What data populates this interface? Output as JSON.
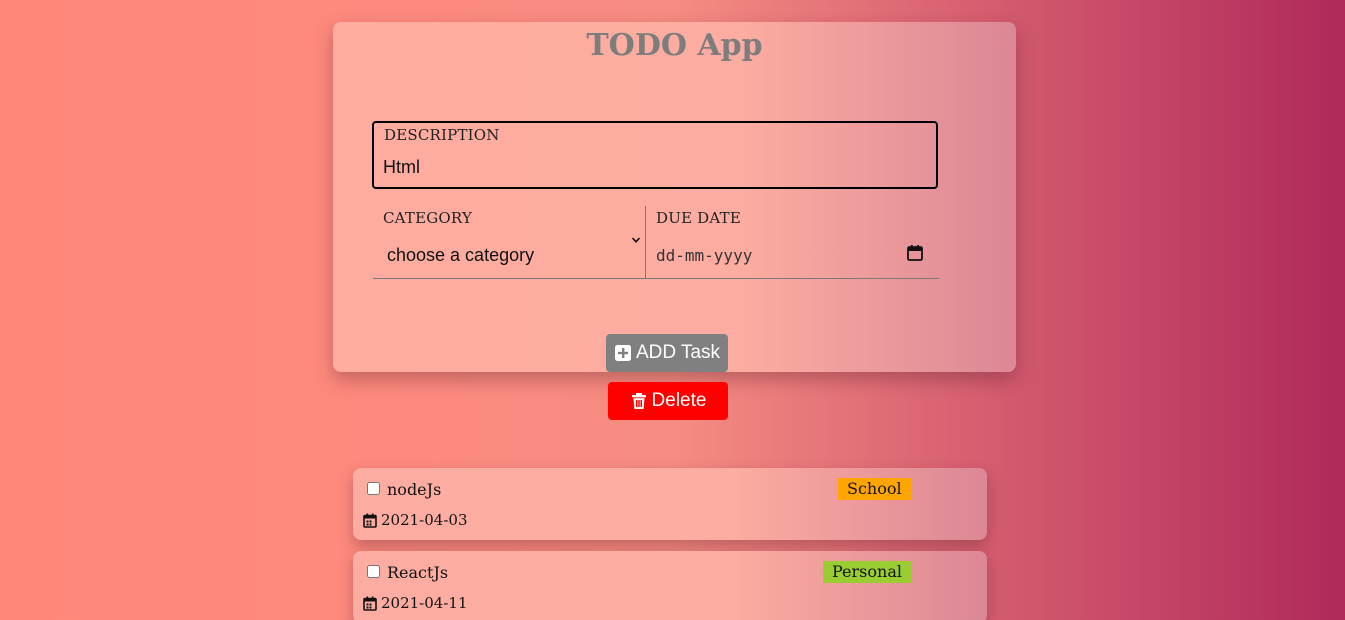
{
  "app": {
    "title": "TODO App"
  },
  "form": {
    "description": {
      "label": "DESCRIPTION",
      "value": "Html"
    },
    "category": {
      "label": "CATEGORY",
      "selected": "choose a category"
    },
    "due_date": {
      "label": "DUE DATE",
      "placeholder": "dd-mm-yyyy",
      "icon": "calendar-icon"
    },
    "add_button": {
      "label": "ADD Task",
      "icon": "plus-square-icon",
      "color": "#808080"
    }
  },
  "delete_button": {
    "label": "Delete",
    "icon": "trash-icon",
    "color": "#ff0000"
  },
  "tasks": [
    {
      "name": "nodeJs",
      "category": "School",
      "category_color": "#ffa500",
      "date": "2021-04-03",
      "checked": false
    },
    {
      "name": "ReactJs",
      "category": "Personal",
      "category_color": "#9acd32",
      "date": "2021-04-11",
      "checked": false
    }
  ]
}
